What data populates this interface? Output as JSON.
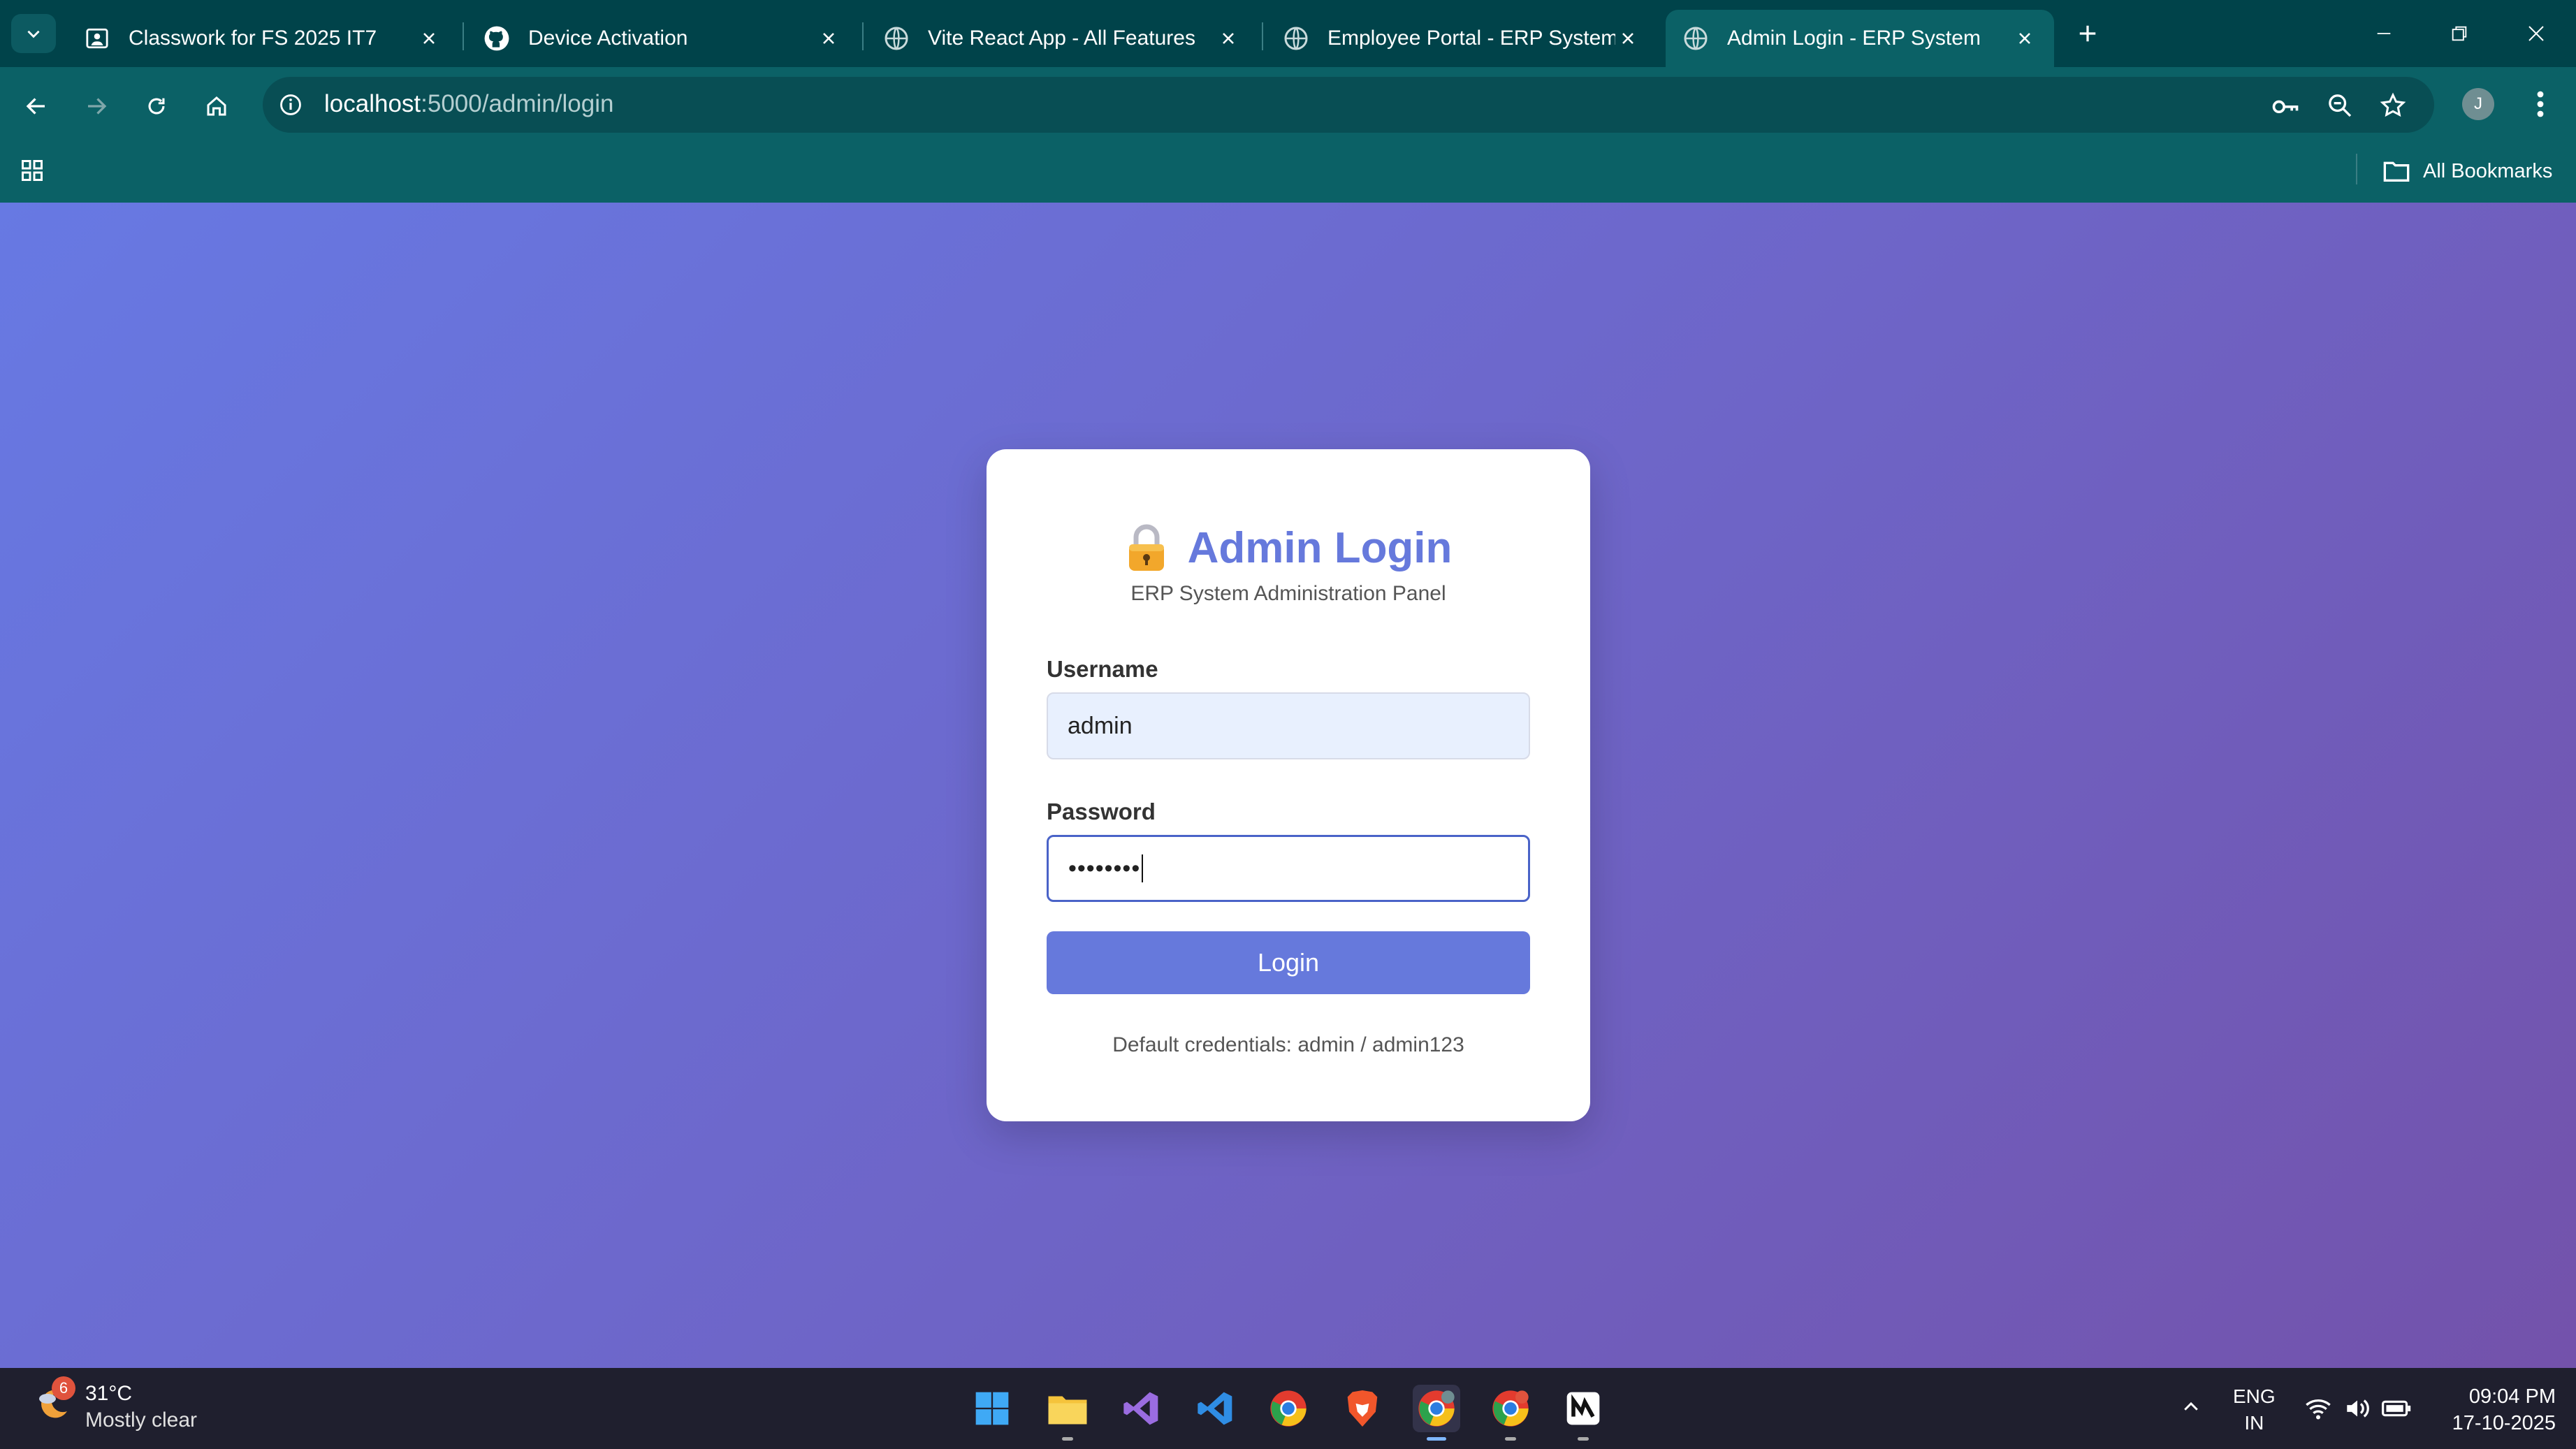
{
  "browser": {
    "tabs": [
      {
        "title": "Classwork for FS 2025 IT7",
        "icon": "classroom-icon",
        "active": false
      },
      {
        "title": "Device Activation",
        "icon": "github-icon",
        "active": false
      },
      {
        "title": "Vite React App - All Features",
        "icon": "globe-icon",
        "active": false
      },
      {
        "title": "Employee Portal - ERP System",
        "icon": "globe-icon",
        "active": false
      },
      {
        "title": "Admin Login - ERP System",
        "icon": "globe-icon",
        "active": true
      }
    ],
    "url_host": "localhost",
    "url_path": ":5000/admin/login",
    "profile_initial": "J",
    "bookmarks_label": "All Bookmarks"
  },
  "login": {
    "title": "Admin Login",
    "subtitle": "ERP System Administration Panel",
    "username_label": "Username",
    "username_value": "admin",
    "password_label": "Password",
    "password_masked": "••••••••",
    "button_label": "Login",
    "hint": "Default credentials: admin / admin123"
  },
  "taskbar": {
    "weather_badge": "6",
    "temperature": "31°C",
    "condition": "Mostly clear",
    "language": "ENG",
    "region": "IN",
    "time": "09:04 PM",
    "date": "17-10-2025"
  },
  "colors": {
    "chrome": "#0b6166",
    "accent": "#6679dc",
    "gradient_start": "#6779e3",
    "gradient_end": "#7352ab"
  }
}
